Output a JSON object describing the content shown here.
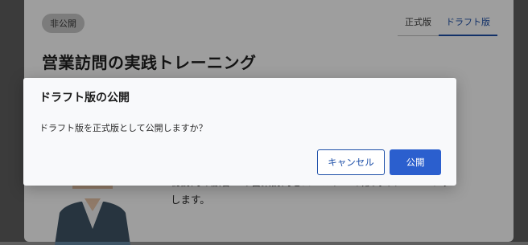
{
  "background": {
    "badge": "非公開",
    "tabs": [
      {
        "label": "正式版",
        "active": false
      },
      {
        "label": "ドラフト版",
        "active": true
      }
    ],
    "title": "営業訪問の実践トレーニング",
    "description_line1": "初訪問の顧客への営業訪問をロールプレイ形式でトレーニング",
    "description_line2": "します。"
  },
  "modal": {
    "title": "ドラフト版の公開",
    "message": "ドラフト版を正式版として公開しますか？",
    "cancel_label": "キャンセル",
    "publish_label": "公開"
  },
  "colors": {
    "primary": "#2b5fce",
    "overlay": "rgba(0,0,0,0.38)"
  }
}
